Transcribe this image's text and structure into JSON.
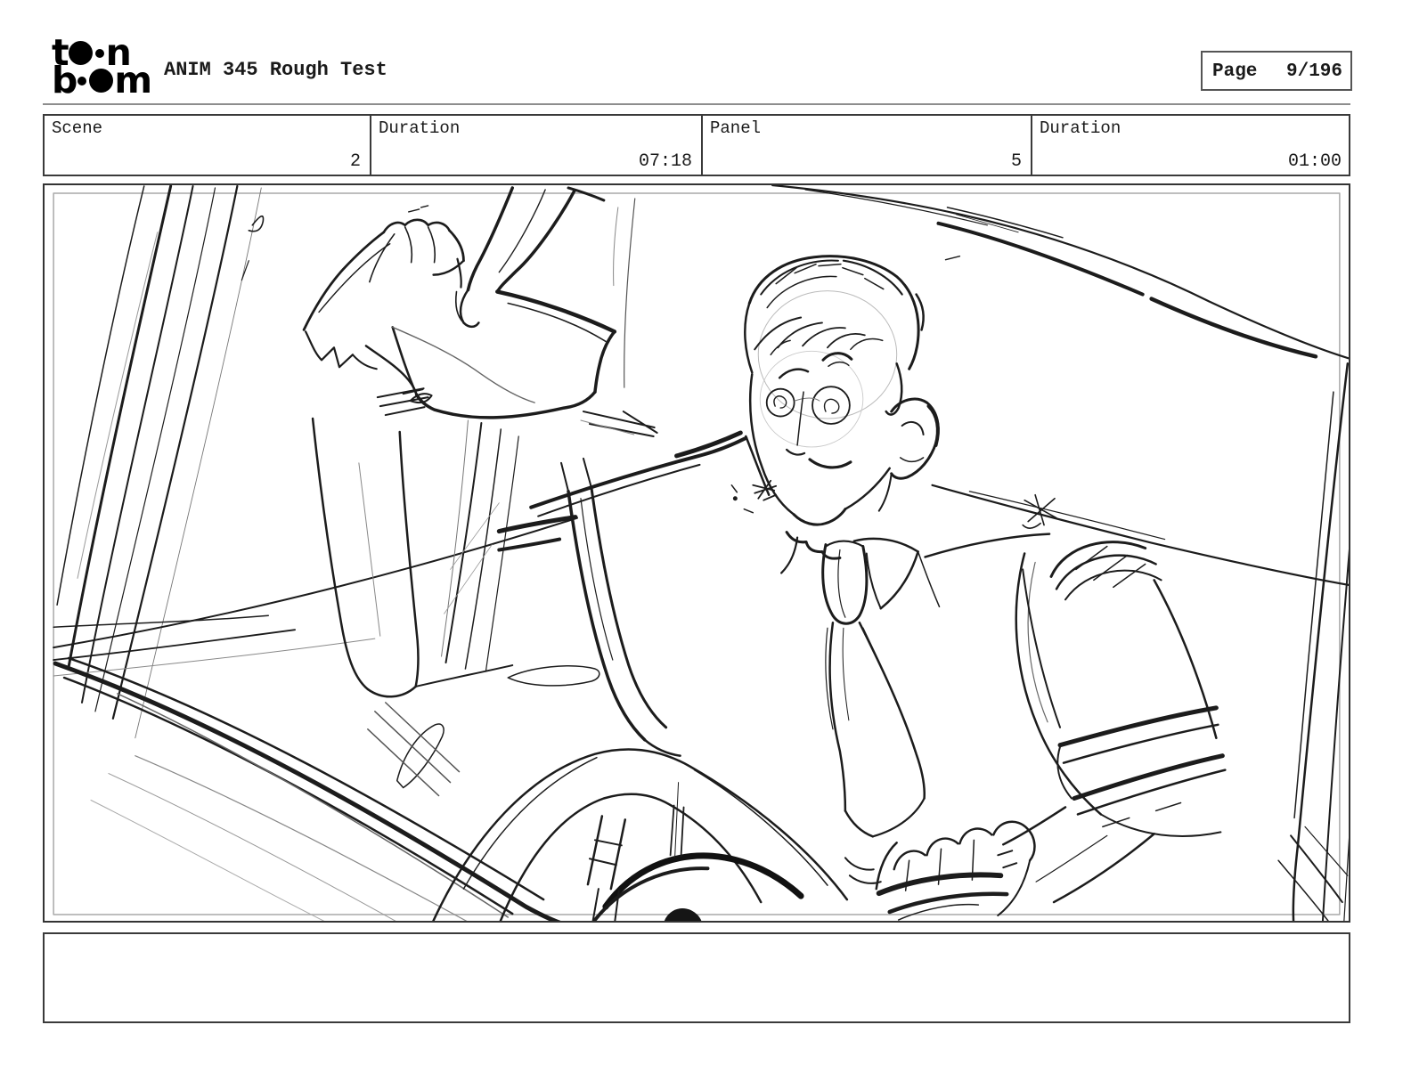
{
  "header": {
    "logo": {
      "t1": "t",
      "t2": "n",
      "b1": "b",
      "b2": "m"
    },
    "title": "ANIM 345 Rough Test",
    "page_label": "Page",
    "page_value": "9/196"
  },
  "info_row": {
    "cells": [
      {
        "label": "Scene",
        "value": "2"
      },
      {
        "label": "Duration",
        "value": "07:18"
      },
      {
        "label": "Panel",
        "value": "5"
      },
      {
        "label": "Duration",
        "value": "01:00"
      }
    ]
  },
  "storyboard": {
    "sketch_alt": "Rough pencil sketch: smiling man in collared shirt and tie driving a car, right hand gripping the steering wheel, left hand reaching up pulling the sun visor, windshield pillar at left and seat at right"
  },
  "caption": {
    "text": ""
  }
}
